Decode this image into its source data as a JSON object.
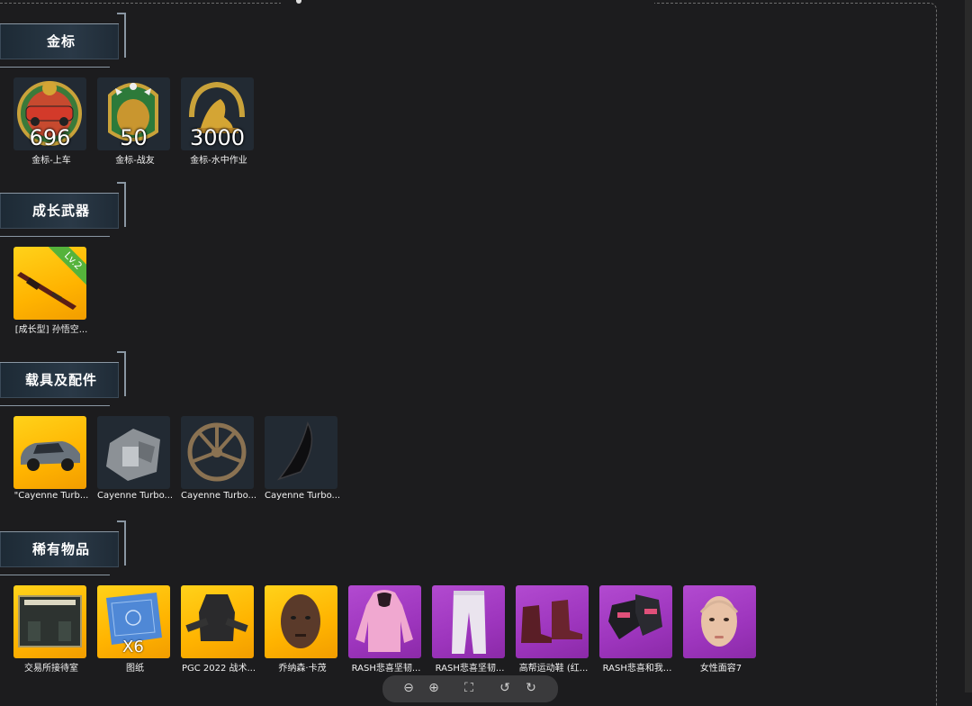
{
  "sections": [
    {
      "title": "金标",
      "items": [
        {
          "label": "金标-上车",
          "count": "696",
          "icon": "gold-badge-car-icon"
        },
        {
          "label": "金标-战友",
          "count": "50",
          "icon": "gold-badge-teammate-icon"
        },
        {
          "label": "金标-水中作业",
          "count": "3000",
          "icon": "gold-badge-water-icon"
        }
      ]
    },
    {
      "title": "成长武器",
      "items": [
        {
          "label": "[成长型] 孙悟空...",
          "level": "Lv.2",
          "icon": "rifle-icon"
        }
      ]
    },
    {
      "title": "载具及配件",
      "items": [
        {
          "label": "\"Cayenne Turb...",
          "icon": "car-icon"
        },
        {
          "label": "Cayenne Turbo...",
          "icon": "engine-part-icon"
        },
        {
          "label": "Cayenne Turbo...",
          "icon": "wheel-icon"
        },
        {
          "label": "Cayenne Turbo...",
          "icon": "car-part-icon"
        }
      ]
    },
    {
      "title": "稀有物品",
      "items": [
        {
          "label": "交易所接待室",
          "icon": "room-icon"
        },
        {
          "label": "图纸",
          "count": "X6",
          "icon": "blueprint-icon"
        },
        {
          "label": "PGC 2022 战术...",
          "icon": "vest-icon"
        },
        {
          "label": "乔纳森·卡茂",
          "icon": "character-face-icon"
        },
        {
          "label": "RASH悲喜坚韧...",
          "icon": "hoodie-icon"
        },
        {
          "label": "RASH悲喜坚韧...",
          "icon": "pants-icon"
        },
        {
          "label": "高帮运动鞋 (红...",
          "icon": "boots-icon"
        },
        {
          "label": "RASH悲喜和我...",
          "icon": "gloves-icon"
        },
        {
          "label": "女性面容7",
          "icon": "female-face-icon"
        }
      ]
    }
  ],
  "toolbar": {
    "zoom_out": "⊖",
    "zoom_in": "⊕",
    "fit": "⛶",
    "rotate_left": "↺",
    "rotate_right": "↻"
  }
}
